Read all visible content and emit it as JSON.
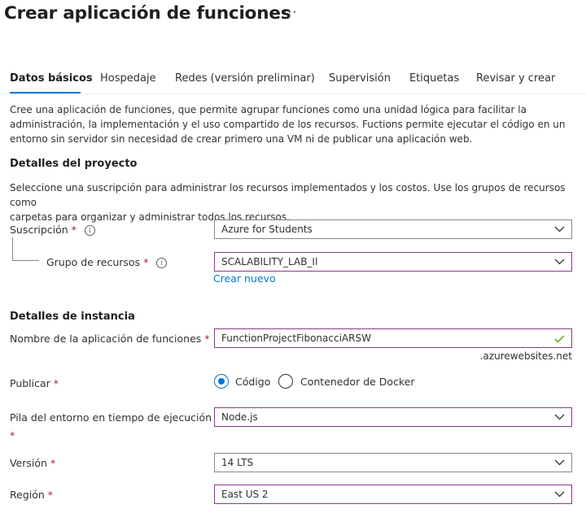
{
  "header": {
    "title": "Crear aplicación de funciones",
    "more": "···"
  },
  "tabs": [
    {
      "label": "Datos básicos"
    },
    {
      "label": "Hospedaje"
    },
    {
      "label": "Redes (versión preliminar)"
    },
    {
      "label": "Supervisión"
    },
    {
      "label": "Etiquetas"
    },
    {
      "label": "Revisar y crear"
    }
  ],
  "intro": {
    "line1": "Cree una aplicación de funciones, que permite agrupar funciones como una unidad lógica para facilitar la",
    "line2": "administración, la implementación y el uso compartido de los recursos. Fuctions permite ejecutar el código en un",
    "line3": "entorno sin servidor sin necesidad de crear primero una VM ni de publicar una aplicación web."
  },
  "project": {
    "heading": "Detalles del proyecto",
    "desc1": "Seleccione una suscripción para administrar los recursos implementados y los costos. Use los grupos de recursos como",
    "desc2": "carpetas para organizar y administrar todos los recursos.",
    "subscription_label": "Suscripción",
    "subscription_value": "Azure for Students",
    "resource_group_label": "Grupo de recursos",
    "resource_group_value": "SCALABILITY_LAB_II",
    "create_new": "Crear nuevo"
  },
  "instance": {
    "heading": "Detalles de instancia",
    "name_label": "Nombre de la aplicación de funciones",
    "name_value": "FunctionProjectFibonacciARSW",
    "name_suffix": ".azurewebsites.net",
    "publish_label": "Publicar",
    "publish_options": [
      "Código",
      "Contenedor de Docker"
    ],
    "publish_selected": "Código",
    "runtime_label": "Pila del entorno en tiempo de ejecución",
    "runtime_value": "Node.js",
    "version_label": "Versión",
    "version_value": "14 LTS",
    "region_label": "Región",
    "region_value": "East US 2"
  },
  "required_mark": "*",
  "info_glyph": "i",
  "colors": {
    "accent": "#0078d4",
    "required": "#a4262c",
    "valid": "#57a300",
    "focus_border": "#8a3a8a"
  }
}
